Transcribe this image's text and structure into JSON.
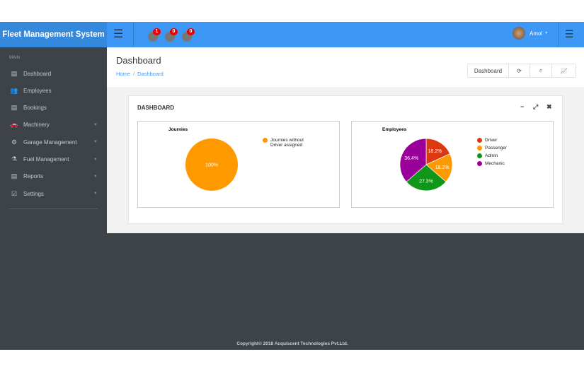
{
  "header": {
    "logo": "Fleet Management System",
    "notifications": [
      {
        "count": "1"
      },
      {
        "count": "0"
      },
      {
        "count": "0"
      }
    ],
    "user": "Amol"
  },
  "sidebar": {
    "section": "MAIN",
    "items": [
      {
        "label": "Dashboard",
        "icon": "book-icon",
        "glyph": "▤",
        "caret": false
      },
      {
        "label": "Employees",
        "icon": "users-icon",
        "glyph": "👥",
        "caret": false
      },
      {
        "label": "Bookings",
        "icon": "book-icon",
        "glyph": "▤",
        "caret": false
      },
      {
        "label": "Machinery",
        "icon": "car-icon",
        "glyph": "🚗",
        "caret": true
      },
      {
        "label": "Garage Management",
        "icon": "cogs-icon",
        "glyph": "⚙",
        "caret": true
      },
      {
        "label": "Fuel Management",
        "icon": "flask-icon",
        "glyph": "⚗",
        "caret": true
      },
      {
        "label": "Reports",
        "icon": "book-icon",
        "glyph": "▤",
        "caret": true
      },
      {
        "label": "Settings",
        "icon": "check-square-icon",
        "glyph": "☑",
        "caret": true
      }
    ]
  },
  "page": {
    "title": "Dashboard",
    "breadcrumb": [
      "Home",
      "Dashboard"
    ],
    "toolbar": {
      "label": "Dashboard"
    }
  },
  "panel": {
    "title": "DASHBOARD"
  },
  "chart_data": [
    {
      "type": "pie",
      "title": "Journies",
      "labels": [
        "Journies without Driver assigned"
      ],
      "values": [
        100
      ],
      "data_labels": [
        "100%"
      ],
      "colors": [
        "#ff9900"
      ],
      "legend": "right"
    },
    {
      "type": "pie",
      "title": "Employees",
      "labels": [
        "Driver",
        "Passenger",
        "Admin",
        "Mechanic"
      ],
      "values": [
        18.2,
        18.2,
        27.3,
        36.4
      ],
      "data_labels": [
        "18.2%",
        "18.2%",
        "27.3%",
        "36.4%"
      ],
      "colors": [
        "#dc3912",
        "#ff9900",
        "#109618",
        "#990099"
      ],
      "legend": "right"
    }
  ],
  "footer": "Copyright© 2018 Acquiscent Technologies Pvt.Ltd."
}
